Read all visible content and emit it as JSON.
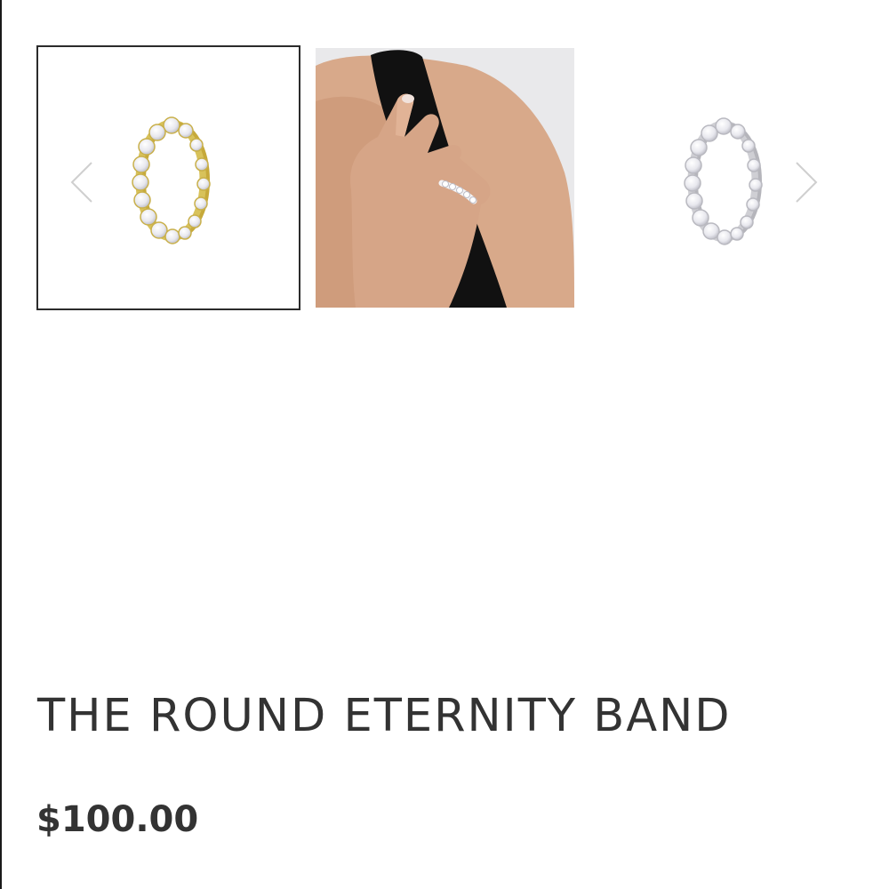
{
  "gallery": {
    "prev_icon": "chevron-left-icon",
    "next_icon": "chevron-right-icon",
    "thumbnails": [
      {
        "variant": "gold",
        "selected": true
      },
      {
        "variant": "worn-on-hand",
        "selected": false
      },
      {
        "variant": "silver",
        "selected": false
      }
    ]
  },
  "product": {
    "title": "THE ROUND ETERNITY BAND",
    "price": "$100.00"
  },
  "colors": {
    "text": "#333333",
    "selected_border": "#2b2b2b",
    "gold_band": "#d8c25a",
    "silver_band": "#c9c9c9"
  }
}
